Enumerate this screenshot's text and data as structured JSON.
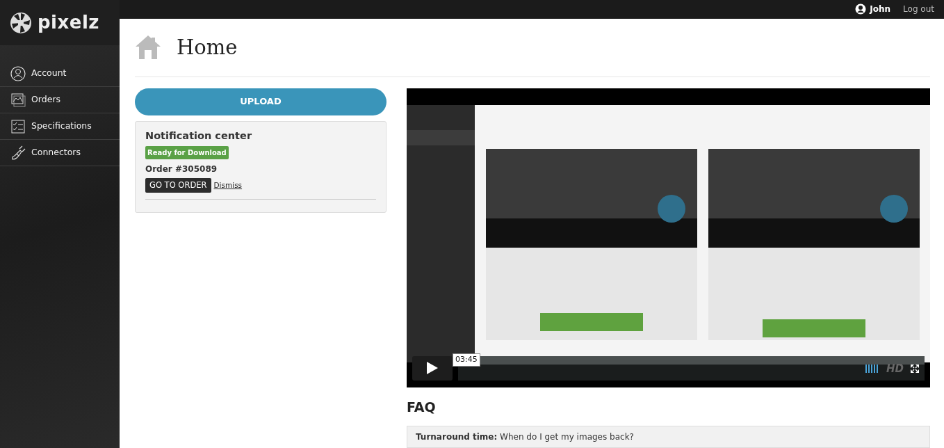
{
  "brand": "pixelz",
  "topbar": {
    "user": "John",
    "logout": "Log out"
  },
  "sidebar": {
    "items": [
      {
        "label": "Account"
      },
      {
        "label": "Orders"
      },
      {
        "label": "Specifications"
      },
      {
        "label": "Connectors"
      }
    ]
  },
  "page": {
    "title": "Home"
  },
  "upload_button": "UPLOAD",
  "notifications": {
    "title": "Notification center",
    "items": [
      {
        "status": "Ready for Download",
        "order": "Order #305089",
        "action": "GO TO ORDER",
        "dismiss": "Dismiss"
      }
    ]
  },
  "video": {
    "kind": "picture",
    "time": "03:45",
    "quality": "HD",
    "progress": {
      "level": 1
    }
  },
  "faq": {
    "title": "FAQ",
    "items": [
      {
        "text": "**Turnaround time:** When do I get my images back?"
      }
    ]
  }
}
